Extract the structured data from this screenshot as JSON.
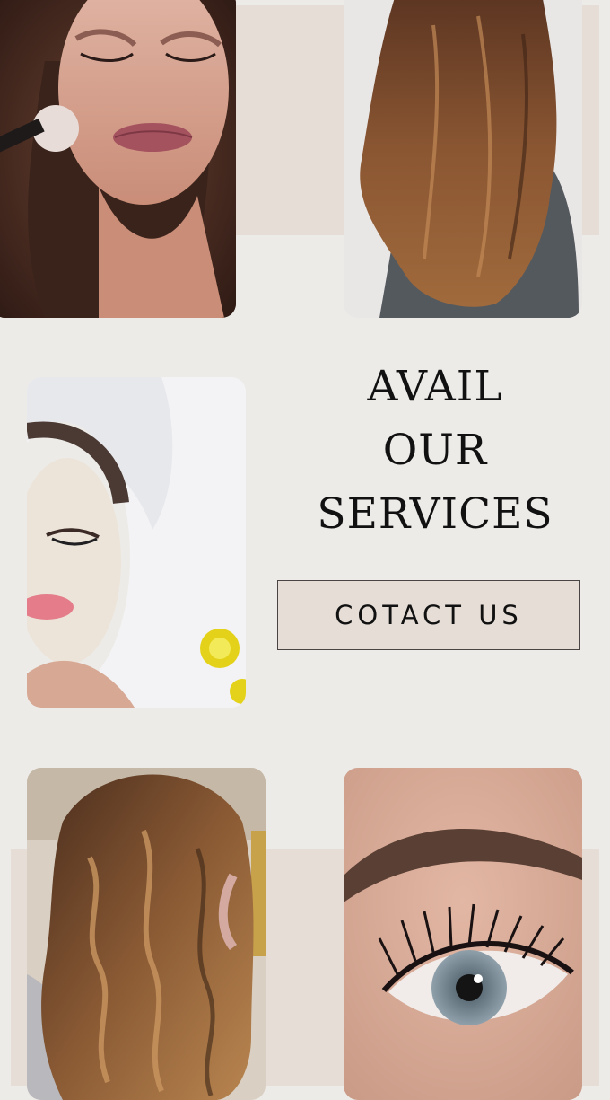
{
  "headline": {
    "line1": "AVAIL",
    "line2": "OUR",
    "line3": "SERVICES"
  },
  "cta": {
    "label": "COTACT US"
  },
  "colors": {
    "background": "#edebe8",
    "panel": "#e5ddd6",
    "text": "#111111"
  },
  "photos": [
    {
      "name": "makeup-photo",
      "subject": "woman applying makeup brush"
    },
    {
      "name": "layered-hair-photo",
      "subject": "long layered brown hair from behind"
    },
    {
      "name": "facial-mask-photo",
      "subject": "woman with facial mask and towel"
    },
    {
      "name": "wavy-hair-photo",
      "subject": "wavy caramel brown hair"
    },
    {
      "name": "eyelash-brow-photo",
      "subject": "close-up of eyebrow and eyelash extensions"
    }
  ]
}
